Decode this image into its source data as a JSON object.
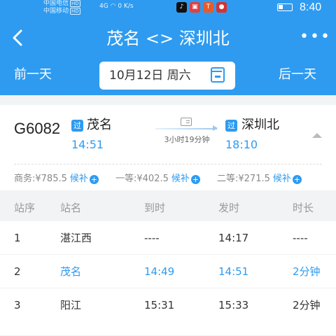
{
  "status_bar": {
    "carrier1": "中国电信",
    "carrier2": "中国移动",
    "hd": "HD",
    "signal": "4G",
    "speed": "0 K/s",
    "time": "8:40"
  },
  "header": {
    "title": "茂名 <> 深圳北",
    "prev_day": "前一天",
    "next_day": "后一天",
    "date": "10月12日 周六",
    "back_icon": "back-arrow-icon",
    "more_icon": "more-icon"
  },
  "train": {
    "number": "G6082",
    "badge": "过",
    "from_station": "茂名",
    "from_time": "14:51",
    "to_station": "深圳北",
    "to_time": "18:10",
    "duration": "3小时19分钟"
  },
  "prices": [
    {
      "label": "商务:",
      "value": "¥785.5",
      "wait": "候补"
    },
    {
      "label": "一等:",
      "value": "¥402.5",
      "wait": "候补"
    },
    {
      "label": "二等:",
      "value": "¥271.5",
      "wait": "候补"
    }
  ],
  "table": {
    "headers": [
      "站序",
      "站名",
      "到时",
      "发时",
      "时长"
    ],
    "rows": [
      {
        "seq": "1",
        "name": "湛江西",
        "arrive": "----",
        "depart": "14:17",
        "stay": "----"
      },
      {
        "seq": "2",
        "name": "茂名",
        "arrive": "14:49",
        "depart": "14:51",
        "stay": "2分钟"
      },
      {
        "seq": "3",
        "name": "阳江",
        "arrive": "15:31",
        "depart": "15:33",
        "stay": "2分钟"
      }
    ]
  },
  "colors": {
    "accent": "#2e9bf0"
  }
}
